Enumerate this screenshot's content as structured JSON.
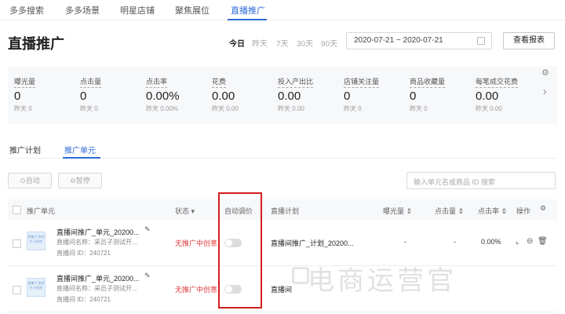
{
  "top_tabs": [
    "多多搜索",
    "多多场景",
    "明星店铺",
    "聚焦展位",
    "直播推广"
  ],
  "page_title": "直播推广",
  "date_options": [
    "今日",
    "昨天",
    "7天",
    "30天",
    "90天"
  ],
  "date_range": "2020-07-21 ~ 2020-07-21",
  "report_button": "查看报表",
  "stats": [
    {
      "label": "曝光量",
      "value": "0",
      "yesterday": "昨天 0"
    },
    {
      "label": "点击量",
      "value": "0",
      "yesterday": "昨天 0"
    },
    {
      "label": "点击率",
      "value": "0.00%",
      "yesterday": "昨天 0.00%"
    },
    {
      "label": "花费",
      "value": "0.00",
      "yesterday": "昨天 0.00"
    },
    {
      "label": "投入产出比",
      "value": "0.00",
      "yesterday": "昨天 0.00"
    },
    {
      "label": "店铺关注量",
      "value": "0",
      "yesterday": "昨天 0"
    },
    {
      "label": "商品收藏量",
      "value": "0",
      "yesterday": "昨天 0"
    },
    {
      "label": "每笔成交花费",
      "value": "0.00",
      "yesterday": "昨天 0.00"
    }
  ],
  "sub_tabs": [
    "推广计划",
    "推广单元"
  ],
  "buttons": {
    "auto": "⊙自动",
    "pause": "⊖暂停"
  },
  "search_placeholder": "输入单元名或商品 ID 搜索",
  "table_headers": {
    "unit": "推广单元",
    "status": "状态 ▾",
    "auto_bid": "自动调价",
    "plan": "直播计划",
    "exposure": "曝光量 ⇕",
    "clicks": "点击量 ⇕",
    "ctr": "点击率 ⇕",
    "ops": "操作"
  },
  "rows": [
    {
      "thumb_text": "采集子 测试开 计划名",
      "name": "直播间推广_单元_20200...",
      "room": "直播间名称：采员子测试开...",
      "room_id": "直播间 ID：240721",
      "status": "无推广中创意",
      "plan": "直播间推广_计划_20200...",
      "exposure": "-",
      "clicks": "-",
      "ctr": "0.00%"
    },
    {
      "thumb_text": "采集子 测试开 计划名",
      "name": "直播间推广_单元_20200...",
      "room": "直播间名称：采员子测试开...",
      "room_id": "直播间 ID：240721",
      "status": "无推广中创意",
      "plan": "直播间",
      "exposure": "",
      "clicks": "",
      "ctr": ""
    }
  ],
  "watermark": "电商运营官"
}
